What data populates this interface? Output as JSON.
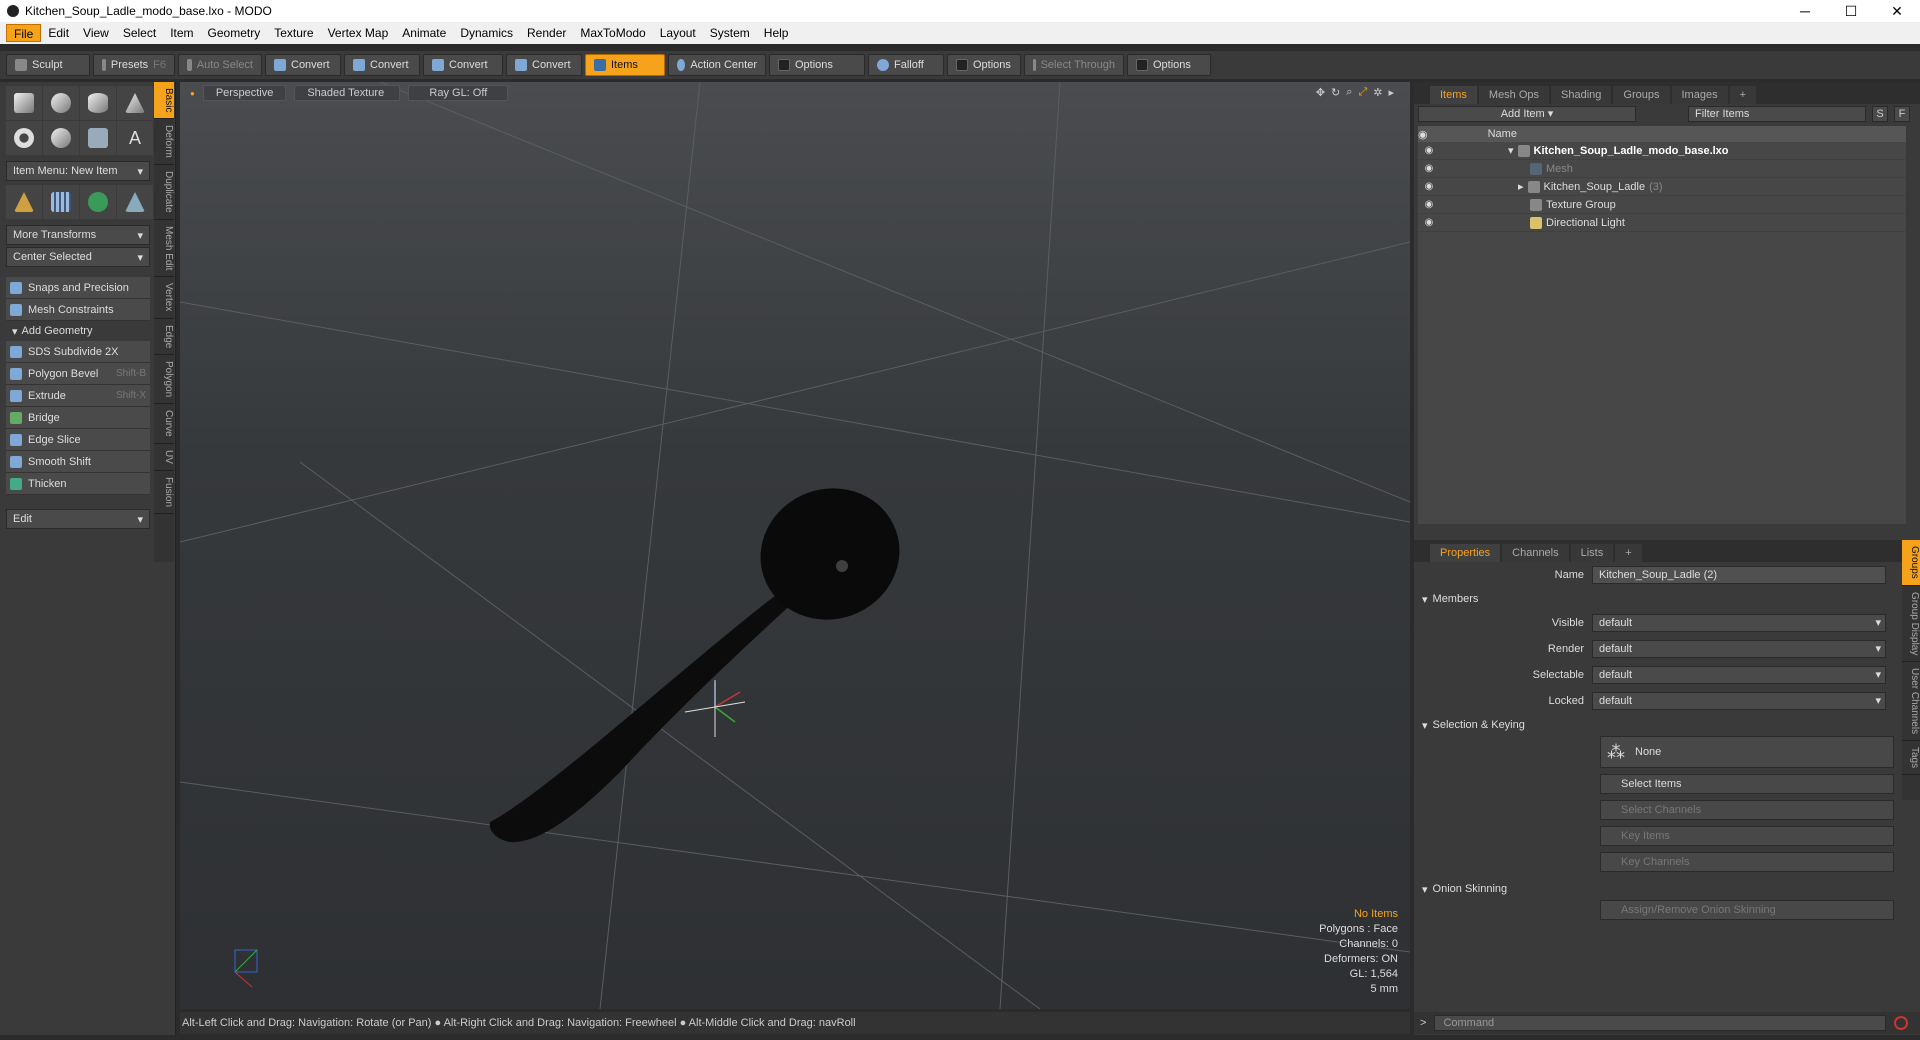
{
  "window": {
    "title": "Kitchen_Soup_Ladle_modo_base.lxo - MODO",
    "min": "─",
    "max": "☐",
    "close": "✕"
  },
  "menu": [
    "File",
    "Edit",
    "View",
    "Select",
    "Item",
    "Geometry",
    "Texture",
    "Vertex Map",
    "Animate",
    "Dynamics",
    "Render",
    "MaxToModo",
    "Layout",
    "System",
    "Help"
  ],
  "toolbar": {
    "sculpt": "Sculpt",
    "presets": "Presets",
    "presets_key": "F6",
    "auto_select": "Auto Select",
    "convert": "Convert",
    "items": "Items",
    "action_center": "Action Center",
    "options": "Options",
    "falloff": "Falloff",
    "select_through": "Select Through"
  },
  "left": {
    "item_menu": "Item Menu: New Item",
    "more_transforms": "More Transforms",
    "center_selected": "Center Selected",
    "snaps": "Snaps and Precision",
    "constraints": "Mesh Constraints",
    "add_geometry": "Add Geometry",
    "tools": [
      {
        "label": "SDS Subdivide 2X",
        "key": ""
      },
      {
        "label": "Polygon Bevel",
        "key": "Shift-B"
      },
      {
        "label": "Extrude",
        "key": "Shift-X"
      },
      {
        "label": "Bridge",
        "key": ""
      },
      {
        "label": "Edge Slice",
        "key": ""
      },
      {
        "label": "Smooth Shift",
        "key": ""
      },
      {
        "label": "Thicken",
        "key": ""
      }
    ],
    "edit": "Edit",
    "vtabs": [
      "Basic",
      "Deform",
      "Duplicate",
      "Mesh Edit",
      "Vertex",
      "Edge",
      "Polygon",
      "Curve",
      "UV",
      "Fusion"
    ]
  },
  "viewport": {
    "perspective": "Perspective",
    "shading": "Shaded Texture",
    "raygl": "Ray GL: Off",
    "info": {
      "no_items": "No Items",
      "polygons": "Polygons : Face",
      "channels": "Channels: 0",
      "deformers": "Deformers: ON",
      "gl": "GL: 1,564",
      "scale": "5 mm"
    }
  },
  "status": "Alt-Left Click and Drag: Navigation: Rotate (or Pan) ● Alt-Right Click and Drag: Navigation: Freewheel ● Alt-Middle Click and Drag: navRoll",
  "items_panel": {
    "tabs": [
      "Items",
      "Mesh Ops",
      "Shading",
      "Groups",
      "Images",
      "+"
    ],
    "add_item": "Add Item",
    "filter": "Filter Items",
    "s": "S",
    "f": "F",
    "col_name": "Name",
    "rows": [
      {
        "label": "Kitchen_Soup_Ladle_modo_base.lxo",
        "count": ""
      },
      {
        "label": "Mesh",
        "count": ""
      },
      {
        "label": "Kitchen_Soup_Ladle",
        "count": "(3)"
      },
      {
        "label": "Texture Group",
        "count": ""
      },
      {
        "label": "Directional Light",
        "count": ""
      }
    ]
  },
  "props_panel": {
    "tabs": [
      "Properties",
      "Channels",
      "Lists",
      "+"
    ],
    "name_label": "Name",
    "name_value": "Kitchen_Soup_Ladle (2)",
    "members": "Members",
    "fields": [
      {
        "label": "Visible",
        "value": "default"
      },
      {
        "label": "Render",
        "value": "default"
      },
      {
        "label": "Selectable",
        "value": "default"
      },
      {
        "label": "Locked",
        "value": "default"
      }
    ],
    "sel_keying": "Selection & Keying",
    "none": "None",
    "select_items": "Select Items",
    "select_channels": "Select Channels",
    "key_items": "Key Items",
    "key_channels": "Key Channels",
    "onion": "Onion Skinning",
    "assign_onion": "Assign/Remove Onion Skinning",
    "vtabs": [
      "Groups",
      "Group Display",
      "User Channels",
      "Tags"
    ]
  },
  "command": {
    "placeholder": "Command",
    "prompt": ">"
  }
}
